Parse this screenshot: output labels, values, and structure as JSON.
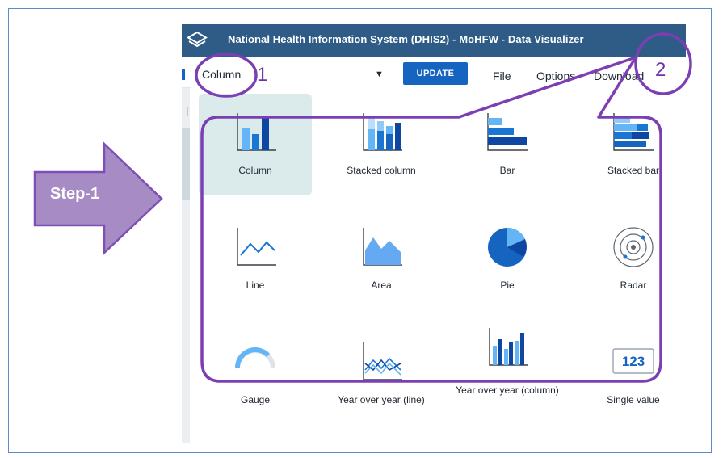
{
  "header": {
    "title": "National Health Information System (DHIS2) - MoHFW - Data Visualizer",
    "logo_icon": "dhis2-logo-icon"
  },
  "toolbar": {
    "visualization_type": "Column",
    "update_label": "UPDATE",
    "menu": [
      "File",
      "Options",
      "Download"
    ]
  },
  "chart_types": [
    {
      "label": "Column",
      "icon": "column-chart-icon",
      "selected": true
    },
    {
      "label": "Stacked column",
      "icon": "stacked-column-chart-icon",
      "selected": false
    },
    {
      "label": "Bar",
      "icon": "bar-chart-icon",
      "selected": false
    },
    {
      "label": "Stacked bar",
      "icon": "stacked-bar-chart-icon",
      "selected": false
    },
    {
      "label": "Line",
      "icon": "line-chart-icon",
      "selected": false
    },
    {
      "label": "Area",
      "icon": "area-chart-icon",
      "selected": false
    },
    {
      "label": "Pie",
      "icon": "pie-chart-icon",
      "selected": false
    },
    {
      "label": "Radar",
      "icon": "radar-chart-icon",
      "selected": false
    },
    {
      "label": "Gauge",
      "icon": "gauge-chart-icon",
      "selected": false
    },
    {
      "label": "Year over year (line)",
      "icon": "year-over-year-line-icon",
      "selected": false
    },
    {
      "label": "Year over year (column)",
      "icon": "year-over-year-column-icon",
      "selected": false
    },
    {
      "label": "Single value",
      "icon": "single-value-icon",
      "icon_text": "123",
      "selected": false
    }
  ],
  "annotations": {
    "step_label": "Step-1",
    "marker_1": "1",
    "marker_2": "2"
  },
  "colors": {
    "header_bg": "#2e5c87",
    "accent": "#1565c0",
    "annotation": "#6b34a6",
    "selected_tile": "#dbeaeb"
  }
}
